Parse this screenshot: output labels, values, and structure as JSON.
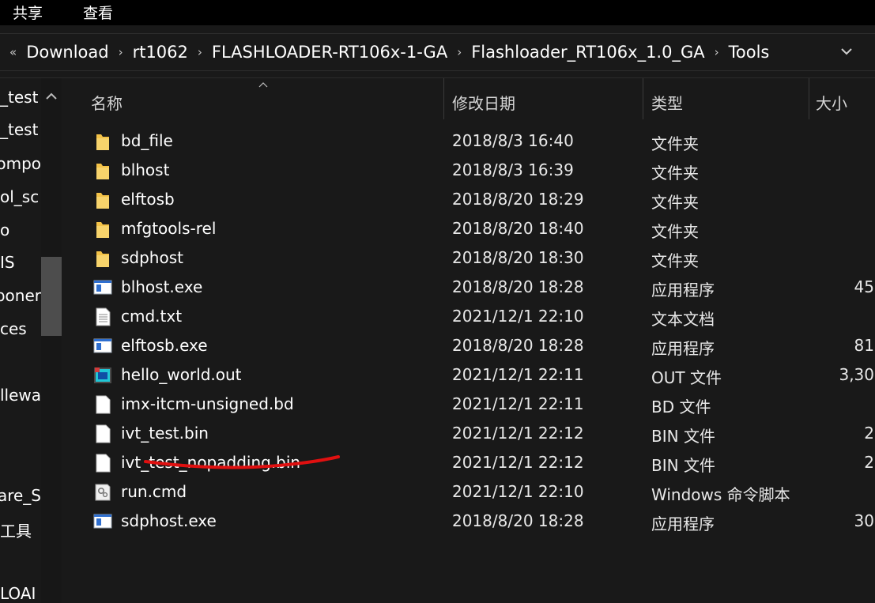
{
  "ribbon": {
    "tabs": [
      "共享",
      "查看"
    ]
  },
  "address_bar": {
    "lead": "«",
    "crumbs": [
      "Download",
      "rt1062",
      "FLASHLOADER-RT106x-1-GA",
      "Flashloader_RT106x_1.0_GA",
      "Tools"
    ],
    "separator": "›"
  },
  "sidebar": {
    "items": [
      "_test",
      "_test",
      "ompo",
      "ol_sc",
      "o",
      "IS",
      "poner",
      "ces",
      "",
      "llewa",
      "",
      "",
      "are_S",
      "工具",
      "",
      "LOAI"
    ]
  },
  "columns": {
    "name": "名称",
    "modified": "修改日期",
    "type": "类型",
    "size": "大小"
  },
  "files": [
    {
      "name": "bd_file",
      "modified": "2018/8/3 16:40",
      "type": "文件夹",
      "size": "",
      "icon": "folder-icon"
    },
    {
      "name": "blhost",
      "modified": "2018/8/3 16:39",
      "type": "文件夹",
      "size": "",
      "icon": "folder-icon"
    },
    {
      "name": "elftosb",
      "modified": "2018/8/20 18:29",
      "type": "文件夹",
      "size": "",
      "icon": "folder-icon"
    },
    {
      "name": "mfgtools-rel",
      "modified": "2018/8/20 18:40",
      "type": "文件夹",
      "size": "",
      "icon": "folder-icon"
    },
    {
      "name": "sdphost",
      "modified": "2018/8/20 18:30",
      "type": "文件夹",
      "size": "",
      "icon": "folder-icon"
    },
    {
      "name": "blhost.exe",
      "modified": "2018/8/20 18:28",
      "type": "应用程序",
      "size": "45",
      "icon": "exe-icon"
    },
    {
      "name": "cmd.txt",
      "modified": "2021/12/1 22:10",
      "type": "文本文档",
      "size": "",
      "icon": "text-file-icon"
    },
    {
      "name": "elftosb.exe",
      "modified": "2018/8/20 18:28",
      "type": "应用程序",
      "size": "81",
      "icon": "exe-icon"
    },
    {
      "name": "hello_world.out",
      "modified": "2021/12/1 22:11",
      "type": "OUT 文件",
      "size": "3,30",
      "icon": "out-file-icon"
    },
    {
      "name": "imx-itcm-unsigned.bd",
      "modified": "2021/12/1 22:11",
      "type": "BD 文件",
      "size": "",
      "icon": "blank-file-icon"
    },
    {
      "name": "ivt_test.bin",
      "modified": "2021/12/1 22:12",
      "type": "BIN 文件",
      "size": "2",
      "icon": "blank-file-icon"
    },
    {
      "name": "ivt_test_nopadding.bin",
      "modified": "2021/12/1 22:12",
      "type": "BIN 文件",
      "size": "2",
      "icon": "blank-file-icon"
    },
    {
      "name": "run.cmd",
      "modified": "2021/12/1 22:10",
      "type": "Windows 命令脚本",
      "size": "",
      "icon": "cmd-file-icon"
    },
    {
      "name": "sdphost.exe",
      "modified": "2018/8/20 18:28",
      "type": "应用程序",
      "size": "30",
      "icon": "exe-icon"
    }
  ],
  "colors": {
    "background": "#191919",
    "ribbon": "#000000",
    "folder": "#f3c247",
    "annotation": "#e01010"
  }
}
